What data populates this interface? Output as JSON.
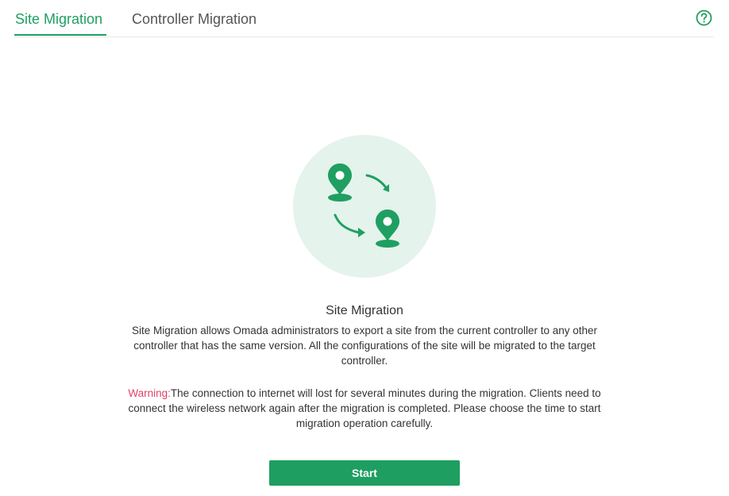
{
  "tabs": {
    "site_migration": "Site Migration",
    "controller_migration": "Controller Migration",
    "active": "site_migration"
  },
  "icons": {
    "help": "help-circle-icon",
    "illustration": "site-migration-illustration-icon"
  },
  "main": {
    "title": "Site Migration",
    "description": "Site Migration allows Omada administrators to export a site from the current controller to any other controller that has the same version. All the configurations of the site will be migrated to the target controller.",
    "warning_label": "Warning:",
    "warning_text": "The connection to internet will lost for several minutes during the migration. Clients need to connect the wireless network again after the migration is completed. Please choose the time to start migration operation carefully.",
    "start_button": "Start"
  },
  "colors": {
    "accent": "#1f9f61",
    "warning": "#e0446a",
    "illustration_bg": "#e4f3ec"
  }
}
